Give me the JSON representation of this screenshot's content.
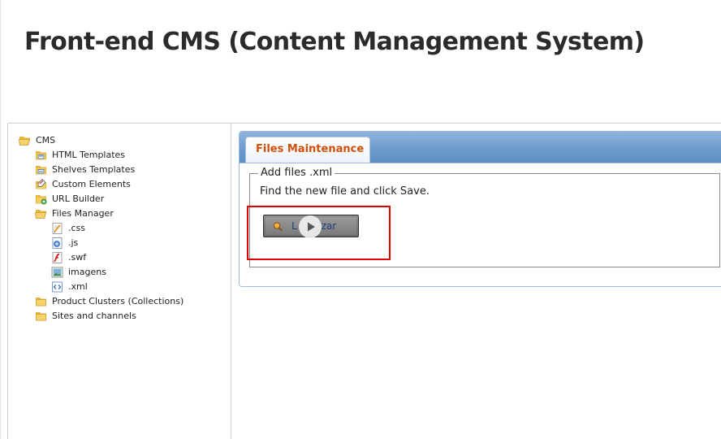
{
  "page": {
    "title": "Front-end CMS (Content Management System)"
  },
  "tree": {
    "root": {
      "label": "CMS",
      "icon": "folder-open-icon"
    },
    "items": [
      {
        "label": "HTML Templates",
        "icon": "templates-icon"
      },
      {
        "label": "Shelves Templates",
        "icon": "shelves-templates-icon"
      },
      {
        "label": "Custom Elements",
        "icon": "custom-elements-icon"
      },
      {
        "label": "URL Builder",
        "icon": "url-builder-icon"
      },
      {
        "label": "Files Manager",
        "icon": "folder-open-icon"
      }
    ],
    "files": [
      {
        "label": ".css",
        "icon": "css-file-icon"
      },
      {
        "label": ".js",
        "icon": "js-file-icon"
      },
      {
        "label": ".swf",
        "icon": "swf-file-icon"
      },
      {
        "label": "imagens",
        "icon": "image-file-icon"
      },
      {
        "label": ".xml",
        "icon": "xml-file-icon"
      }
    ],
    "bottom": [
      {
        "label": "Product Clusters (Collections)",
        "icon": "folder-icon"
      },
      {
        "label": "Sites and channels",
        "icon": "folder-icon"
      }
    ]
  },
  "panel": {
    "tab_label": "Files Maintenance",
    "legend": "Add files .xml",
    "instruction": "Find the new file and click Save.",
    "browse_button_label": "Localizar",
    "browse_button_visible_label_parts": [
      "L",
      "zar"
    ]
  },
  "colors": {
    "tab_text": "#d24f0a",
    "panel_header": "#6e9ccd",
    "highlight": "#e00000"
  }
}
